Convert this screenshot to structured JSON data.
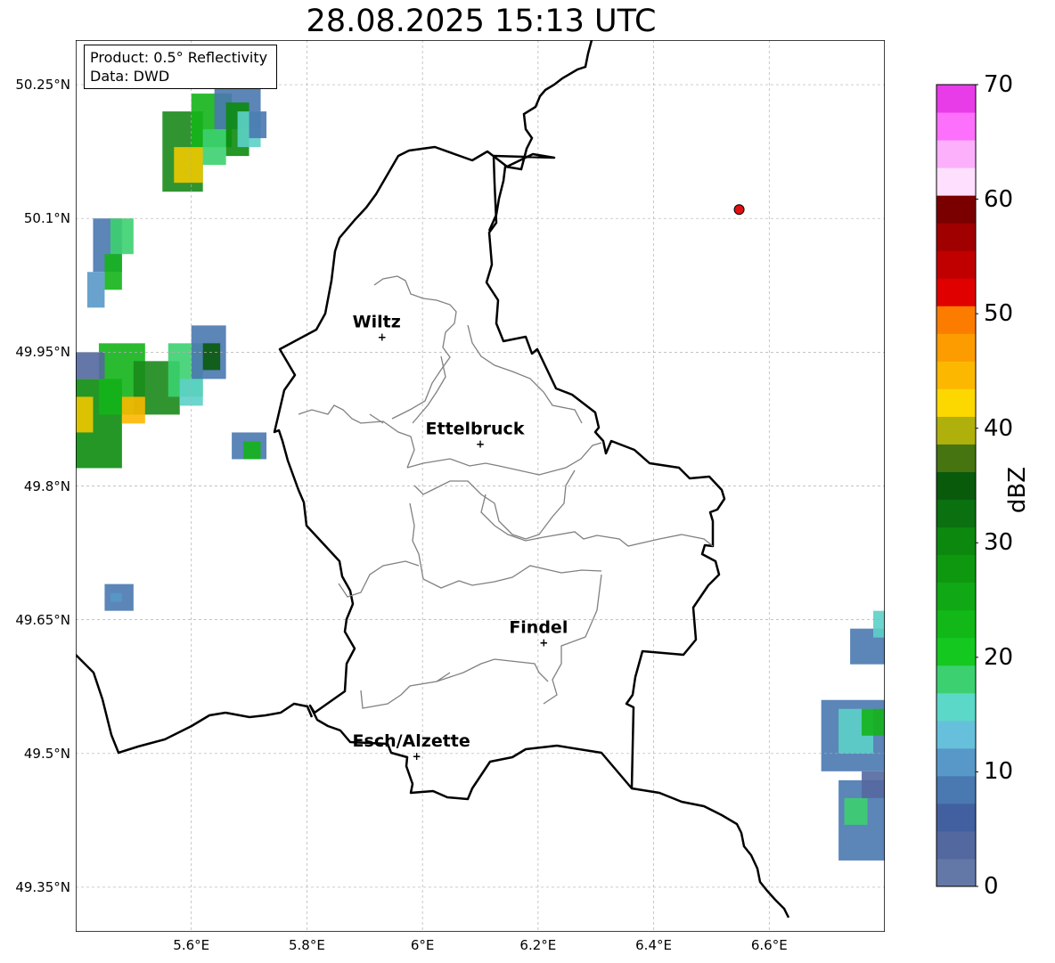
{
  "title": "28.08.2025 15:13 UTC",
  "info_box": {
    "product": "Product: 0.5° Reflectivity",
    "data": "Data: DWD"
  },
  "map": {
    "lon_range": [
      5.4,
      6.8
    ],
    "lat_range": [
      49.3,
      50.3
    ],
    "lat_ticks": [
      "50.25°N",
      "50.1°N",
      "49.95°N",
      "49.8°N",
      "49.65°N",
      "49.5°N",
      "49.35°N"
    ],
    "lon_ticks": [
      "5.6°E",
      "5.8°E",
      "6°E",
      "6.2°E",
      "6.4°E",
      "6.6°E"
    ],
    "grid": true,
    "cities": [
      {
        "name": "Wiltz",
        "lon": 5.93,
        "lat": 49.968
      },
      {
        "name": "Ettelbruck",
        "lon": 6.1,
        "lat": 49.848
      },
      {
        "name": "Findel",
        "lon": 6.21,
        "lat": 49.625
      },
      {
        "name": "Esch/Alzette",
        "lon": 5.99,
        "lat": 49.498
      }
    ],
    "radar_site": {
      "lon": 6.548,
      "lat": 50.11,
      "color": "#e01010"
    }
  },
  "colorbar": {
    "label": "dBZ",
    "min": 0,
    "max": 70,
    "ticks": [
      "0",
      "10",
      "20",
      "30",
      "40",
      "50",
      "60",
      "70"
    ],
    "colors": [
      "#6478a8",
      "#5468a0",
      "#4260a0",
      "#4a78b0",
      "#5898c8",
      "#66c0dc",
      "#5cd8c8",
      "#3cd070",
      "#14c820",
      "#12b818",
      "#10a814",
      "#0e9810",
      "#0c880e",
      "#0a7010",
      "#0a5a0c",
      "#457410",
      "#b0b00c",
      "#fcd800",
      "#fcb800",
      "#fc9c00",
      "#fc7c00",
      "#e00000",
      "#c00000",
      "#a00000",
      "#7a0000",
      "#fee0fe",
      "#fcb0fc",
      "#fc70fc",
      "#e83ce8"
    ]
  },
  "radar_echoes": [
    {
      "area": "northwest",
      "cells": [
        [
          5.55,
          50.22,
          5.62,
          50.13,
          "#1a8a1a"
        ],
        [
          5.6,
          50.24,
          5.67,
          50.18,
          "#14b41a"
        ],
        [
          5.57,
          50.18,
          5.62,
          50.14,
          "#f0c800"
        ],
        [
          5.64,
          50.26,
          5.72,
          50.2,
          "#4a78b0"
        ],
        [
          5.66,
          50.23,
          5.7,
          50.17,
          "#0c8c10"
        ],
        [
          5.68,
          50.22,
          5.72,
          50.18,
          "#5cd0c8"
        ],
        [
          5.62,
          50.2,
          5.66,
          50.16,
          "#3cd070"
        ],
        [
          5.7,
          50.22,
          5.73,
          50.19,
          "#4a78b0"
        ]
      ]
    },
    {
      "area": "west-north",
      "cells": [
        [
          5.43,
          50.1,
          5.48,
          50.04,
          "#4a78b0"
        ],
        [
          5.46,
          50.1,
          5.5,
          50.06,
          "#3cd070"
        ],
        [
          5.45,
          50.06,
          5.48,
          50.02,
          "#14b41a"
        ],
        [
          5.42,
          50.04,
          5.45,
          50.0,
          "#5898c8"
        ]
      ]
    },
    {
      "area": "west",
      "cells": [
        [
          5.4,
          49.92,
          5.48,
          49.82,
          "#0c8c10"
        ],
        [
          5.44,
          49.96,
          5.52,
          49.88,
          "#14b41a"
        ],
        [
          5.5,
          49.94,
          5.58,
          49.88,
          "#1a8a1a"
        ],
        [
          5.56,
          49.96,
          5.62,
          49.9,
          "#3cd070"
        ],
        [
          5.6,
          49.98,
          5.66,
          49.92,
          "#4a78b0"
        ],
        [
          5.4,
          49.9,
          5.43,
          49.86,
          "#f0c800"
        ],
        [
          5.48,
          49.9,
          5.52,
          49.87,
          "#fcb800"
        ],
        [
          5.62,
          49.96,
          5.65,
          49.93,
          "#0a5a0c"
        ],
        [
          5.4,
          49.95,
          5.45,
          49.92,
          "#5468a0"
        ],
        [
          5.58,
          49.92,
          5.62,
          49.89,
          "#5cd0c8"
        ]
      ]
    },
    {
      "area": "west-small",
      "cells": [
        [
          5.67,
          49.86,
          5.73,
          49.83,
          "#4a78b0"
        ],
        [
          5.69,
          49.85,
          5.72,
          49.83,
          "#14b41a"
        ],
        [
          5.45,
          49.69,
          5.5,
          49.66,
          "#4a78b0"
        ],
        [
          5.46,
          49.68,
          5.48,
          49.67,
          "#5898c8"
        ]
      ]
    },
    {
      "area": "east",
      "cells": [
        [
          6.74,
          49.64,
          6.8,
          49.6,
          "#4a78b0"
        ],
        [
          6.78,
          49.66,
          6.8,
          49.63,
          "#5cd0c8"
        ],
        [
          6.69,
          49.56,
          6.8,
          49.48,
          "#4a78b0"
        ],
        [
          6.72,
          49.55,
          6.78,
          49.5,
          "#5cd0c8"
        ],
        [
          6.76,
          49.55,
          6.8,
          49.52,
          "#14b41a"
        ],
        [
          6.72,
          49.47,
          6.8,
          49.38,
          "#4a78b0"
        ],
        [
          6.73,
          49.45,
          6.77,
          49.42,
          "#3cd070"
        ],
        [
          6.76,
          49.48,
          6.8,
          49.45,
          "#5468a0"
        ]
      ]
    }
  ]
}
